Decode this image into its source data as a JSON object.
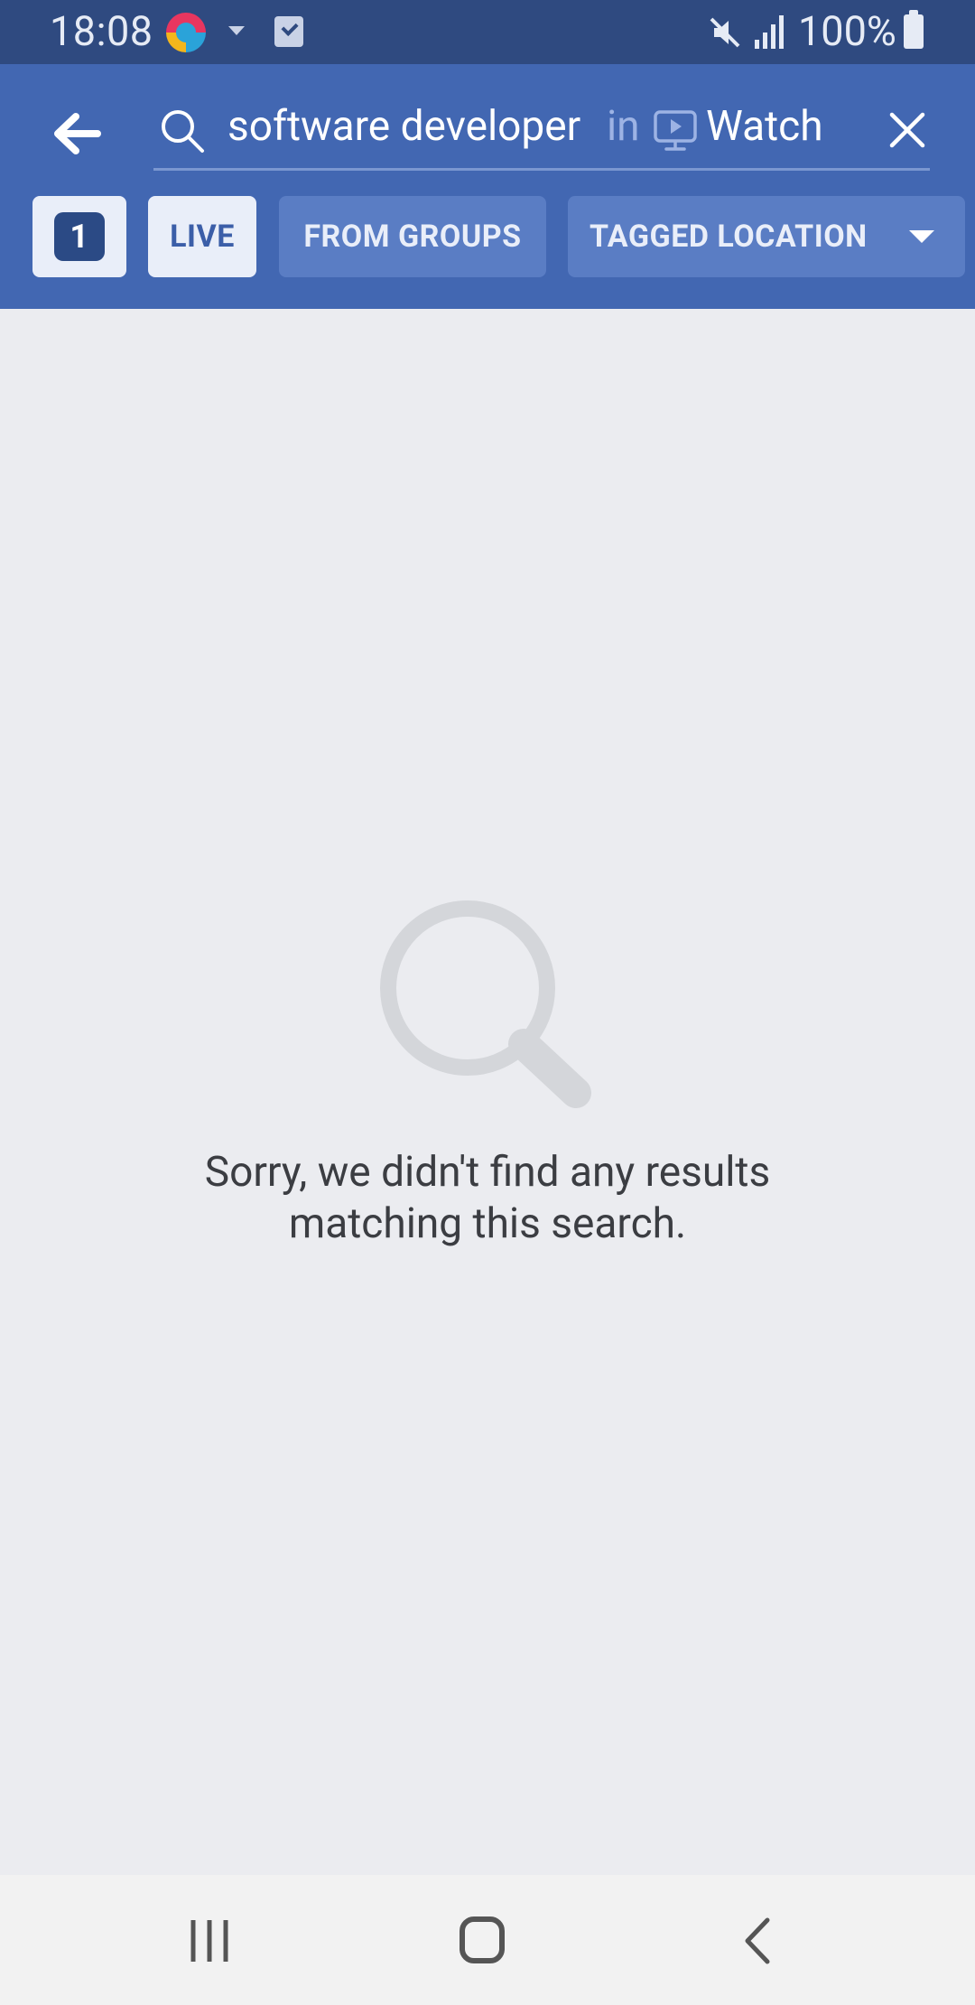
{
  "status_bar": {
    "time": "18:08",
    "battery": "100%",
    "icons": [
      "browser-app-icon",
      "caret-down-icon",
      "task-check-icon",
      "mute-icon",
      "signal-icon",
      "battery-icon"
    ]
  },
  "search": {
    "query": "software developer",
    "in_label": "in",
    "scope": "Watch"
  },
  "filters": {
    "count": "1",
    "chips": [
      {
        "label": "LIVE",
        "active": true
      },
      {
        "label": "FROM GROUPS",
        "active": false
      },
      {
        "label": "TAGGED LOCATION",
        "active": false
      }
    ]
  },
  "empty_state": {
    "line1": "Sorry, we didn't find any results",
    "line2": "matching this search."
  },
  "colors": {
    "status_bar": "#2f4a80",
    "app_bar": "#4267b2",
    "background": "#ebecf0",
    "nav_bar": "#f2f2f2"
  }
}
